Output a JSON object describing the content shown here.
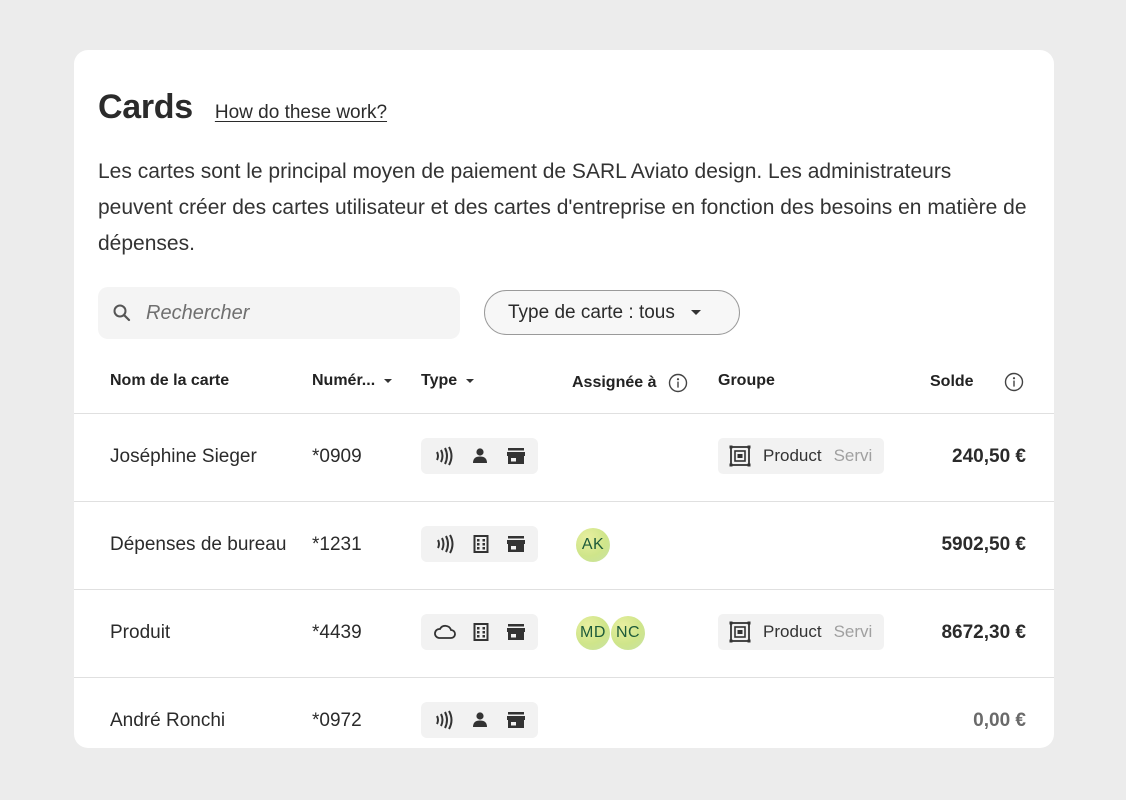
{
  "header": {
    "title": "Cards",
    "help_link": "How do these work?",
    "description": "Les cartes sont le principal moyen de paiement de SARL Aviato design. Les administrateurs peuvent créer des cartes utilisateur et des cartes d'entreprise en fonction des besoins en matière de dépenses."
  },
  "search": {
    "placeholder": "Rechercher",
    "icon": "search-icon"
  },
  "filter": {
    "label": "Type de carte : tous",
    "icon": "caret-down-icon"
  },
  "columns": {
    "name": "Nom de la carte",
    "number": "Numér...",
    "type": "Type",
    "assigned": "Assignée à",
    "group": "Groupe",
    "balance": "Solde"
  },
  "rows": [
    {
      "name": "Joséphine Sieger",
      "number": "*0909",
      "type_icons": [
        "contactless-icon",
        "person-icon",
        "store-icon"
      ],
      "assignees": [],
      "group": {
        "name": "Product",
        "sub": "Servi"
      },
      "balance": "240,50 €"
    },
    {
      "name": "Dépenses de bureau",
      "number": "*1231",
      "type_icons": [
        "contactless-icon",
        "building-icon",
        "store-icon"
      ],
      "assignees": [
        "AK"
      ],
      "group": null,
      "balance": "5902,50 €"
    },
    {
      "name": "Produit",
      "number": "*4439",
      "type_icons": [
        "cloud-icon",
        "building-icon",
        "store-icon"
      ],
      "assignees": [
        "MD",
        "NC"
      ],
      "group": {
        "name": "Product",
        "sub": "Servi"
      },
      "balance": "8672,30 €"
    },
    {
      "name": "André Ronchi",
      "number": "*0972",
      "type_icons": [
        "contactless-icon",
        "person-icon",
        "store-icon"
      ],
      "assignees": [],
      "group": null,
      "balance": "0,00 €"
    }
  ],
  "colors": {
    "background": "#ececec",
    "card": "#ffffff",
    "avatar": "#cfe58a",
    "avatar_text": "#1d5b3a",
    "chip": "#f2f2f2"
  }
}
